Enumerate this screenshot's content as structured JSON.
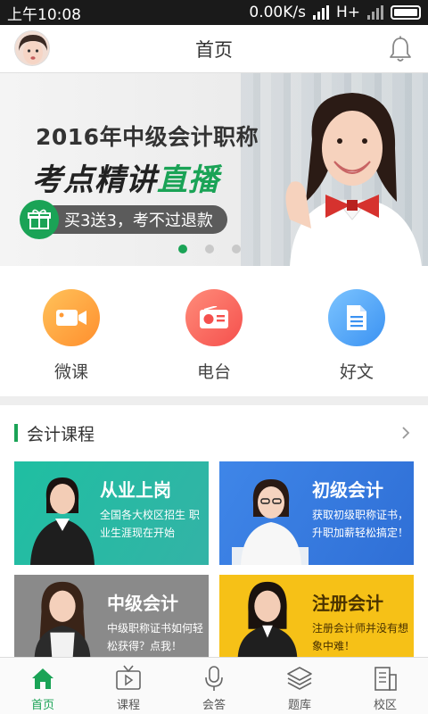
{
  "status_bar": {
    "time": "上午10:08",
    "speed": "0.00K/s",
    "network": "H+"
  },
  "header": {
    "title": "首页"
  },
  "banner": {
    "line1": "2016年中级会计职称",
    "line2_a": "考点精讲",
    "line2_b": "直播",
    "promo": "买3送3，考不过退款",
    "dots": 3,
    "active_dot": 0
  },
  "quick_nav": [
    {
      "label": "微课",
      "icon": "video-camera-icon",
      "color": "#ff9a35"
    },
    {
      "label": "电台",
      "icon": "radio-icon",
      "color": "#f65a52"
    },
    {
      "label": "好文",
      "icon": "document-icon",
      "color": "#4a9cf4"
    }
  ],
  "section": {
    "title": "会计课程"
  },
  "courses": [
    {
      "title": "从业上岗",
      "desc": "全国各大校区招生 职业生涯现在开始",
      "color": "#28bba4"
    },
    {
      "title": "初级会计",
      "desc": "获取初级职称证书，升职加薪轻松搞定！",
      "color": "#3a7de2"
    },
    {
      "title": "中级会计",
      "desc": "中级职称证书如何轻松获得？点我！",
      "color": "#8a8a8a"
    },
    {
      "title": "注册会计",
      "desc": "注册会计师并没有想象中难！",
      "color": "#f6c117"
    }
  ],
  "tabs": [
    {
      "label": "首页",
      "icon": "home-icon",
      "active": true
    },
    {
      "label": "课程",
      "icon": "tv-icon",
      "active": false
    },
    {
      "label": "会答",
      "icon": "microphone-icon",
      "active": false
    },
    {
      "label": "题库",
      "icon": "layers-icon",
      "active": false
    },
    {
      "label": "校区",
      "icon": "building-icon",
      "active": false
    }
  ],
  "colors": {
    "accent": "#1aa356"
  }
}
